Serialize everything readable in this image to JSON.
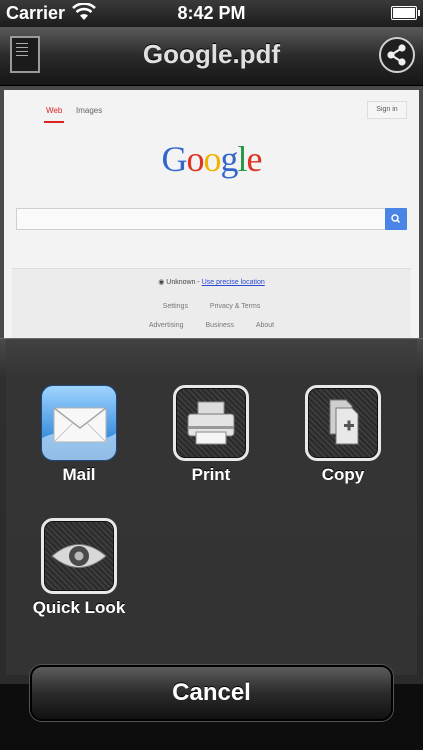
{
  "status": {
    "carrier": "Carrier",
    "time": "8:42 PM"
  },
  "nav": {
    "title": "Google.pdf",
    "doc_icon": "document-icon",
    "share_icon": "share-icon"
  },
  "preview": {
    "tabs": [
      "Web",
      "Images"
    ],
    "signin": "Sign in",
    "logo_letters": [
      {
        "char": "G",
        "color": "#3366cc"
      },
      {
        "char": "o",
        "color": "#dd3322"
      },
      {
        "char": "o",
        "color": "#f0b400"
      },
      {
        "char": "g",
        "color": "#3366cc"
      },
      {
        "char": "l",
        "color": "#229944"
      },
      {
        "char": "e",
        "color": "#dd3322"
      }
    ],
    "location_prefix": "◉ Unknown - ",
    "location_link": "Use precise location",
    "footer_links_1": [
      "Settings",
      "Privacy & Terms"
    ],
    "footer_links_2": [
      "Advertising",
      "Business",
      "About"
    ]
  },
  "actions": [
    {
      "label": "Mail",
      "icon": "mail-icon"
    },
    {
      "label": "Print",
      "icon": "printer-icon"
    },
    {
      "label": "Copy",
      "icon": "copy-icon"
    },
    {
      "label": "Quick Look",
      "icon": "eye-icon"
    }
  ],
  "cancel_label": "Cancel"
}
